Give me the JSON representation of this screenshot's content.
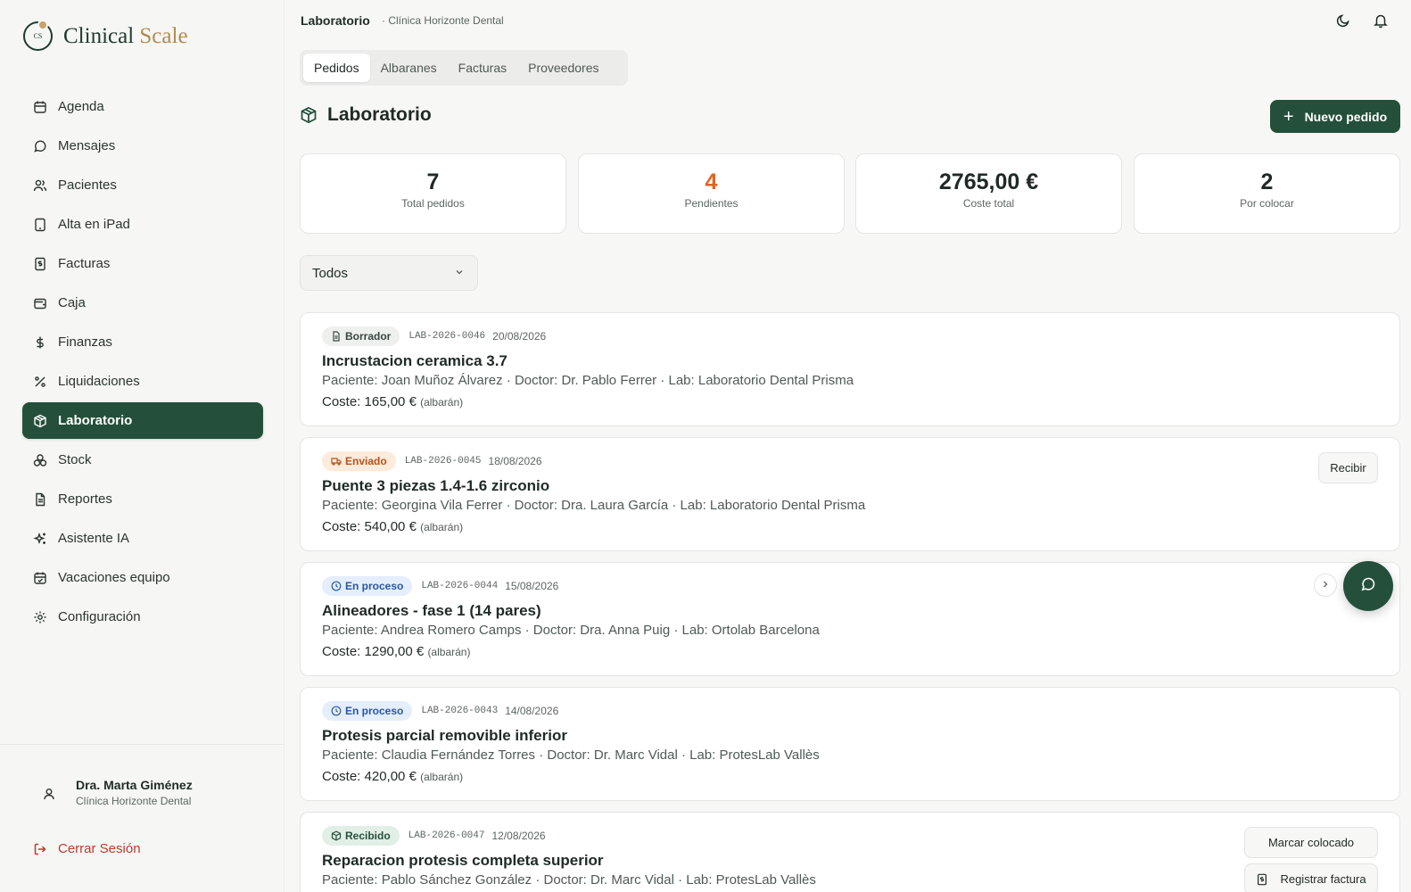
{
  "brand": {
    "name_main": "Clinical",
    "name_accent": "Scale",
    "mark_text": "CS"
  },
  "header": {
    "title": "Laboratorio",
    "subtitle": "· Clínica Horizonte Dental"
  },
  "sidebar": {
    "items": [
      {
        "label": "Agenda",
        "icon": "calendar-icon"
      },
      {
        "label": "Mensajes",
        "icon": "message-icon"
      },
      {
        "label": "Pacientes",
        "icon": "users-icon"
      },
      {
        "label": "Alta en iPad",
        "icon": "tablet-icon"
      },
      {
        "label": "Facturas",
        "icon": "invoice-icon"
      },
      {
        "label": "Caja",
        "icon": "wallet-icon"
      },
      {
        "label": "Finanzas",
        "icon": "dollar-icon"
      },
      {
        "label": "Liquidaciones",
        "icon": "percent-icon"
      },
      {
        "label": "Laboratorio",
        "icon": "package-icon",
        "active": true
      },
      {
        "label": "Stock",
        "icon": "boxes-icon"
      },
      {
        "label": "Reportes",
        "icon": "report-icon"
      },
      {
        "label": "Asistente IA",
        "icon": "sparkles-icon"
      },
      {
        "label": "Vacaciones equipo",
        "icon": "calendar-check-icon"
      },
      {
        "label": "Configuración",
        "icon": "gear-icon"
      }
    ],
    "user": {
      "name": "Dra. Marta Giménez",
      "clinic": "Clínica Horizonte Dental"
    },
    "logout": "Cerrar Sesión"
  },
  "tabs": [
    {
      "label": "Pedidos",
      "active": true
    },
    {
      "label": "Albaranes"
    },
    {
      "label": "Facturas"
    },
    {
      "label": "Proveedores"
    }
  ],
  "page": {
    "title": "Laboratorio",
    "new_button": "Nuevo pedido"
  },
  "stats": [
    {
      "value": "7",
      "label": "Total pedidos"
    },
    {
      "value": "4",
      "label": "Pendientes",
      "color": "#e0651f"
    },
    {
      "value": "2765,00 €",
      "label": "Coste total"
    },
    {
      "value": "2",
      "label": "Por colocar"
    }
  ],
  "filter": {
    "selected": "Todos"
  },
  "orders": [
    {
      "status": "Borrador",
      "code": "LAB-2026-0046",
      "date": "20/08/2026",
      "title": "Incrustacion ceramica 3.7",
      "meta": "Paciente: Joan Muñoz Álvarez · Doctor: Dr. Pablo Ferrer · Lab: Laboratorio Dental Prisma",
      "cost": "Coste: 165,00 €",
      "cost_note": "(albarán)"
    },
    {
      "status": "Enviado",
      "code": "LAB-2026-0045",
      "date": "18/08/2026",
      "title": "Puente 3 piezas 1.4-1.6 zirconio",
      "meta": "Paciente: Georgina Vila Ferrer · Doctor: Dra. Laura García · Lab: Laboratorio Dental Prisma",
      "cost": "Coste: 540,00 €",
      "cost_note": "(albarán)",
      "action": "Recibir"
    },
    {
      "status": "En proceso",
      "code": "LAB-2026-0044",
      "date": "15/08/2026",
      "title": "Alineadores - fase 1 (14 pares)",
      "meta": "Paciente: Andrea Romero Camps · Doctor: Dra. Anna Puig · Lab: Ortolab Barcelona",
      "cost": "Coste: 1290,00 €",
      "cost_note": "(albarán)"
    },
    {
      "status": "En proceso",
      "code": "LAB-2026-0043",
      "date": "14/08/2026",
      "title": "Protesis parcial removible inferior",
      "meta": "Paciente: Claudia Fernández Torres · Doctor: Dr. Marc Vidal · Lab: ProtesLab Vallès",
      "cost": "Coste: 420,00 €",
      "cost_note": "(albarán)"
    },
    {
      "status": "Recibido",
      "code": "LAB-2026-0047",
      "date": "12/08/2026",
      "title": "Reparacion protesis completa superior",
      "meta": "Paciente: Pablo Sánchez González · Doctor: Dr. Marc Vidal · Lab: ProtesLab Vallès",
      "action": "Marcar colocado",
      "action2": "Registrar factura"
    }
  ],
  "colors": {
    "brand": "#24503b",
    "accent": "#c9a36b",
    "orange": "#e0651f",
    "danger": "#c0392b"
  }
}
